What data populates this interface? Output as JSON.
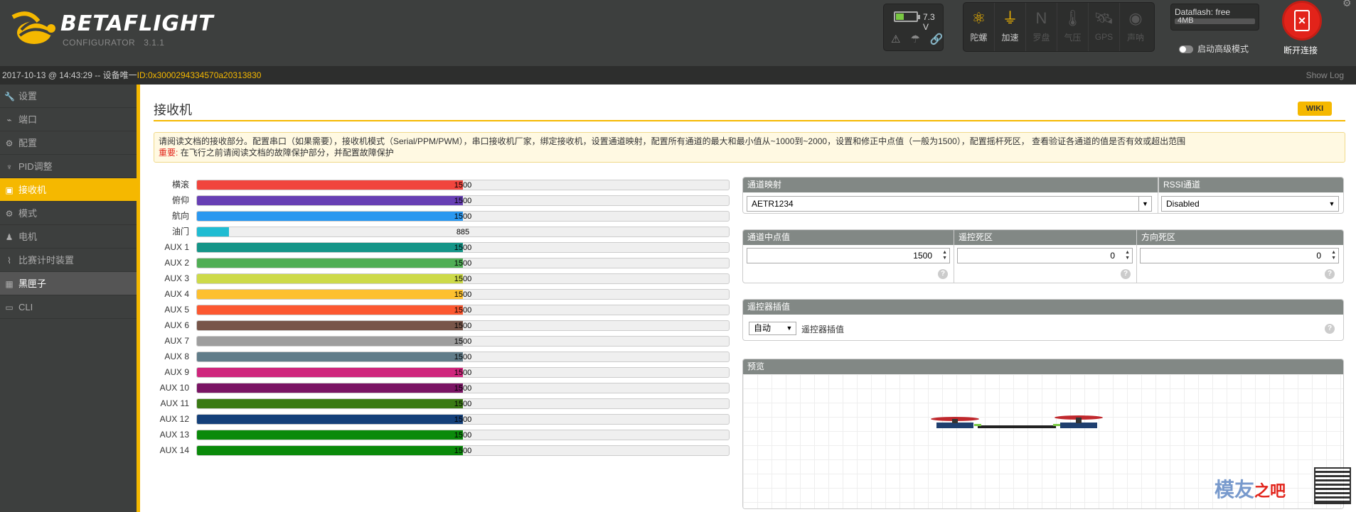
{
  "header": {
    "logo_text": "BETAFLIGHT",
    "logo_sub": "CONFIGURATOR",
    "version": "3.1.1",
    "battery_voltage": "7.3 V",
    "battery_level": 0.35,
    "sensors": [
      {
        "label": "陀螺",
        "icon": "gyro-icon",
        "on": true
      },
      {
        "label": "加速",
        "icon": "accel-icon",
        "on": true
      },
      {
        "label": "罗盘",
        "icon": "compass-icon",
        "on": false
      },
      {
        "label": "气压",
        "icon": "baro-icon",
        "on": false
      },
      {
        "label": "GPS",
        "icon": "gps-icon",
        "on": false
      },
      {
        "label": "声呐",
        "icon": "sonar-icon",
        "on": false
      }
    ],
    "dataflash_title": "Dataflash: free",
    "dataflash_size": "4MB",
    "expert_mode_label": "启动高级模式",
    "disconnect_label": "断开连接"
  },
  "statusbar": {
    "prefix": "2017-10-13 @ 14:43:29 -- 设备唯一",
    "device_id": "ID:0x3000294334570a20313830",
    "show_log": "Show Log"
  },
  "sidebar": {
    "items": [
      {
        "label": "设置",
        "icon": "wrench-icon"
      },
      {
        "label": "端口",
        "icon": "plug-icon"
      },
      {
        "label": "配置",
        "icon": "gear-icon"
      },
      {
        "label": "PID调整",
        "icon": "sliders-icon"
      },
      {
        "label": "接收机",
        "icon": "receiver-icon"
      },
      {
        "label": "模式",
        "icon": "modes-icon"
      },
      {
        "label": "电机",
        "icon": "motor-icon"
      },
      {
        "label": "比赛计时装置",
        "icon": "timer-icon"
      },
      {
        "label": "黑匣子",
        "icon": "blackbox-icon"
      },
      {
        "label": "CLI",
        "icon": "terminal-icon"
      }
    ]
  },
  "main": {
    "title": "接收机",
    "wiki": "WIKI",
    "note_line1": "请阅读文档的接收部分。配置串口（如果需要），接收机模式（Serial/PPM/PWM），串口接收机厂家，绑定接收机，设置通道映射，配置所有通道的最大和最小值从~1000到~2000，设置和修正中点值（一般为1500），配置摇杆死区， 查看验证各通道的值是否有效或超出范围",
    "note_important": "重要:",
    "note_line2": "在飞行之前请阅读文档的故障保护部分，并配置故障保护"
  },
  "channels": [
    {
      "name": "横滚",
      "value": 1500,
      "color": "#f1453d"
    },
    {
      "name": "俯仰",
      "value": 1500,
      "color": "#673fb4"
    },
    {
      "name": "航向",
      "value": 1500,
      "color": "#2b98f0"
    },
    {
      "name": "油门",
      "value": 885,
      "color": "#1fbcd2"
    },
    {
      "name": "AUX 1",
      "value": 1500,
      "color": "#159588"
    },
    {
      "name": "AUX 2",
      "value": 1500,
      "color": "#50ae55"
    },
    {
      "name": "AUX 3",
      "value": 1500,
      "color": "#cdda49"
    },
    {
      "name": "AUX 4",
      "value": 1500,
      "color": "#fdc02f"
    },
    {
      "name": "AUX 5",
      "value": 1500,
      "color": "#fc5830"
    },
    {
      "name": "AUX 6",
      "value": 1500,
      "color": "#785549"
    },
    {
      "name": "AUX 7",
      "value": 1500,
      "color": "#9e9e9e"
    },
    {
      "name": "AUX 8",
      "value": 1500,
      "color": "#617d8a"
    },
    {
      "name": "AUX 9",
      "value": 1500,
      "color": "#cf267d"
    },
    {
      "name": "AUX 10",
      "value": 1500,
      "color": "#7a1464"
    },
    {
      "name": "AUX 11",
      "value": 1500,
      "color": "#3a7a14"
    },
    {
      "name": "AUX 12",
      "value": 1500,
      "color": "#14407a"
    },
    {
      "name": "AUX 13",
      "value": 1500,
      "color": "#0a8a0a"
    },
    {
      "name": "AUX 14",
      "value": 1500,
      "color": "#0a8a0a"
    }
  ],
  "channel_range": [
    800,
    2200
  ],
  "mapping": {
    "label": "通道映射",
    "value": "AETR1234",
    "rssi_label": "RSSI通道",
    "rssi_value": "Disabled"
  },
  "midpoints": {
    "mid_label": "通道中点值",
    "mid_value": "1500",
    "deadband_label": "遥控死区",
    "deadband_value": "0",
    "yaw_deadband_label": "方向死区",
    "yaw_deadband_value": "0"
  },
  "interpolation": {
    "header": "遥控器插值",
    "value": "自动",
    "label": "遥控器插值"
  },
  "preview": {
    "header": "预览"
  },
  "watermark": {
    "text": "模友",
    "text2": "之吧"
  }
}
